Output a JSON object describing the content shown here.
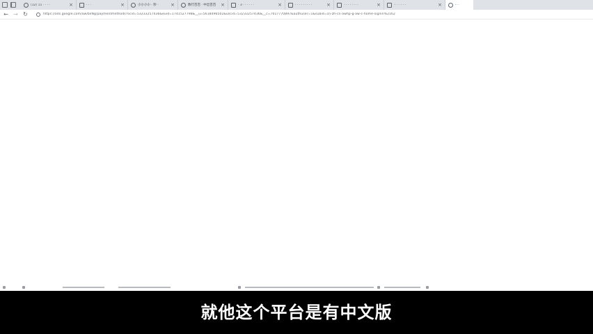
{
  "tabs": [
    {
      "label": "(12) 11 · · · ·",
      "favicon": "github-icon"
    },
    {
      "label": "· · ·",
      "favicon": "page-icon"
    },
    {
      "label": "小小小小 · 秒 ·",
      "favicon": "reload-icon"
    },
    {
      "label": "数行百百 · 中出百百",
      "favicon": "sync-icon"
    },
    {
      "label": "· 3 · · · · · ·",
      "favicon": "doc-icon"
    },
    {
      "label": "· · · · · · · · ·",
      "favicon": "doc-icon"
    },
    {
      "label": "· · · · · · · ·",
      "favicon": "doc-icon"
    },
    {
      "label": "·· · · · · ·",
      "favicon": "page-icon"
    },
    {
      "label": "·· ·",
      "favicon": "google-icon"
    }
  ],
  "address_bar": {
    "url": "https://ads.google.com/aw/bilNg/paymentmethods?ocid=53233257436&euid=1741527798&__u=5618496502&uscid=53233257436&__c=7017770897&authuser=1&subid=cn-zh-cn-awhp-g-aw-c-home-signin%2162"
  },
  "subtitle": {
    "text": "就他这个平台是有中文版"
  },
  "colors": {
    "tabstrip": "#dfe3e8",
    "subtitle_bg": "#000000",
    "subtitle_fg": "#ffffff"
  }
}
